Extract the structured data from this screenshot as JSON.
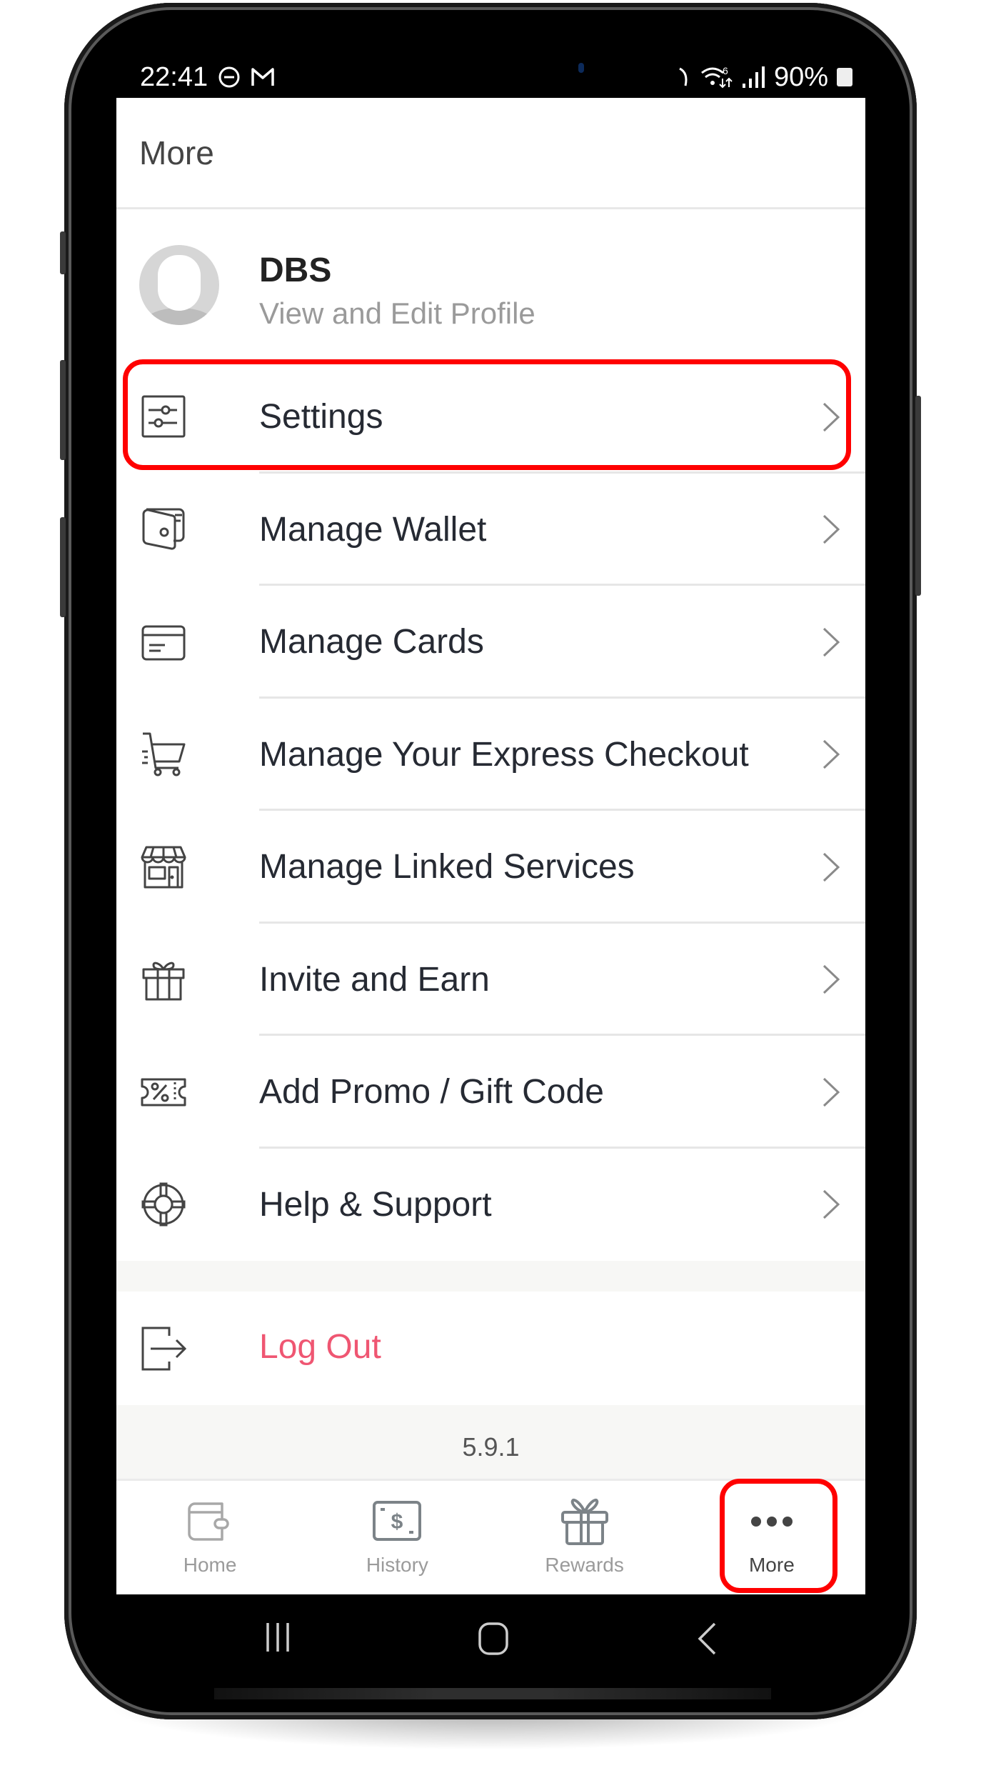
{
  "status_bar": {
    "time": "22:41",
    "left_icons": [
      "do-not-disturb-icon",
      "gmail-icon"
    ],
    "right_icons": [
      "alarm-icon",
      "wifi-6-icon",
      "signal-icon"
    ],
    "battery": "90%"
  },
  "header": {
    "title": "More"
  },
  "profile": {
    "name": "DBS",
    "subtitle": "View and Edit Profile"
  },
  "menu": {
    "items": [
      {
        "label": "Settings",
        "icon": "sliders-icon",
        "highlighted": true
      },
      {
        "label": "Manage Wallet",
        "icon": "wallet-icon"
      },
      {
        "label": "Manage Cards",
        "icon": "card-icon"
      },
      {
        "label": "Manage Your Express Checkout",
        "icon": "cart-icon"
      },
      {
        "label": "Manage Linked Services",
        "icon": "storefront-icon"
      },
      {
        "label": "Invite and Earn",
        "icon": "gift-icon"
      },
      {
        "label": "Add Promo / Gift Code",
        "icon": "coupon-icon"
      },
      {
        "label": "Help & Support",
        "icon": "lifebuoy-icon"
      }
    ]
  },
  "logout": {
    "label": "Log Out",
    "icon": "logout-icon",
    "color": "#ef5672"
  },
  "version": "5.9.1",
  "tabs": [
    {
      "label": "Home",
      "icon": "wallet-icon",
      "active": false
    },
    {
      "label": "History",
      "icon": "receipt-dollar-icon",
      "active": false
    },
    {
      "label": "Rewards",
      "icon": "gift-icon",
      "active": false
    },
    {
      "label": "More",
      "icon": "more-dots-icon",
      "active": true
    }
  ],
  "annotation_color": "#ff0000",
  "system_nav": [
    "recents-icon",
    "home-icon",
    "back-icon"
  ]
}
